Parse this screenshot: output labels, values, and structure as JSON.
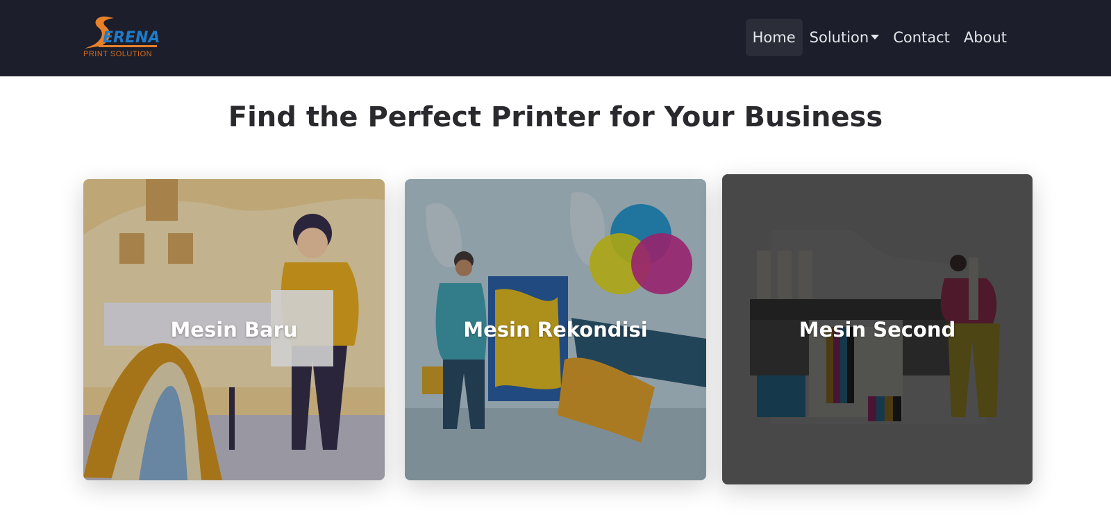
{
  "navbar": {
    "logo_text": "ERENA",
    "logo_subtext": "PRINT SOLUTION",
    "items": [
      {
        "label": "Home"
      },
      {
        "label": "Solution"
      },
      {
        "label": "Contact"
      },
      {
        "label": "About"
      }
    ]
  },
  "main": {
    "heading": "Find the Perfect Printer for Your Business",
    "cards": [
      {
        "title": "Mesin Baru",
        "icon": "printer-illustration-icon"
      },
      {
        "title": "Mesin Rekondisi",
        "icon": "printer-illustration-icon"
      },
      {
        "title": "Mesin Second",
        "icon": "printer-illustration-icon"
      }
    ]
  },
  "colors": {
    "navbar_bg": "#1c1f2b",
    "logo_orange": "#e8812a",
    "logo_blue": "#1f7ac9",
    "heading": "#2a2a2e"
  }
}
